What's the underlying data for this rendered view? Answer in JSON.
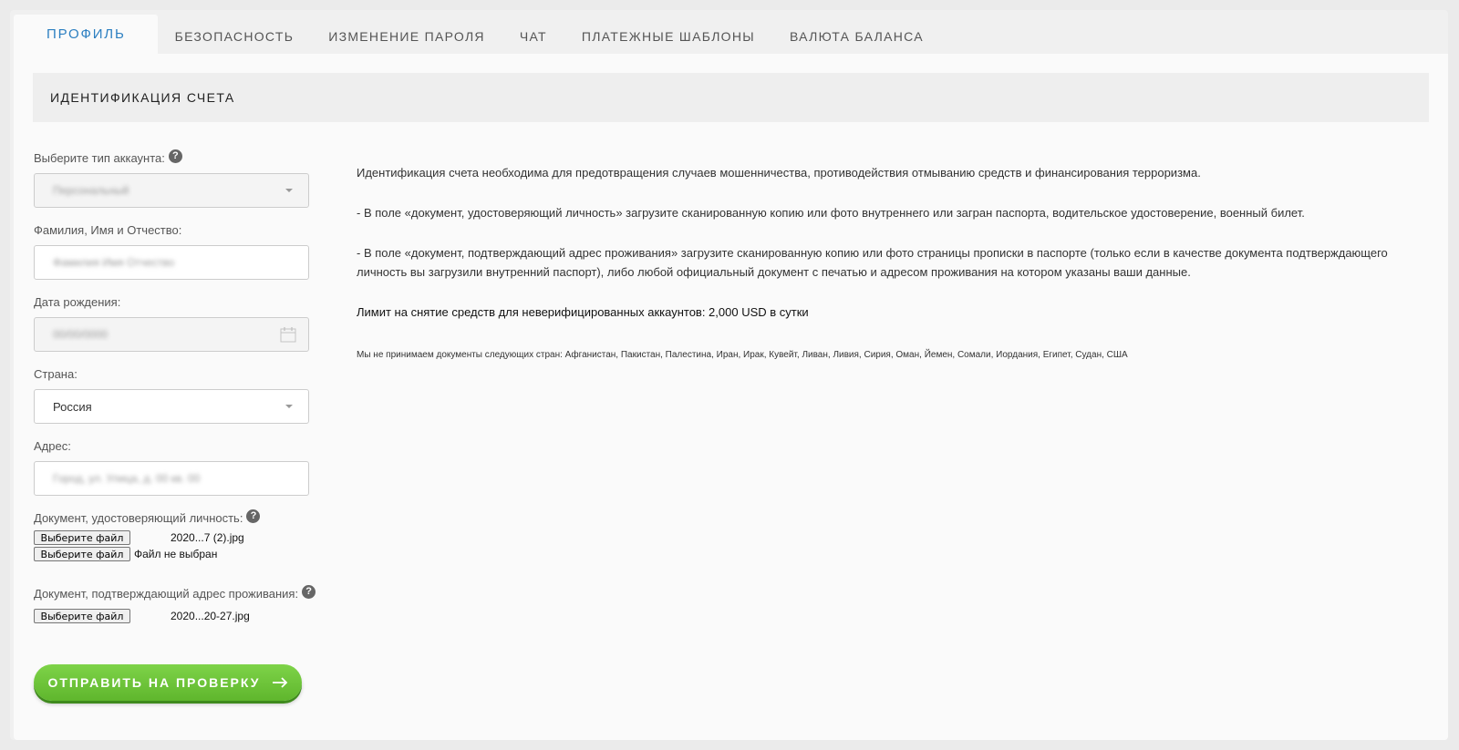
{
  "tabs": [
    {
      "label": "ПРОФИЛЬ",
      "active": true
    },
    {
      "label": "БЕЗОПАСНОСТЬ"
    },
    {
      "label": "ИЗМЕНЕНИЕ ПАРОЛЯ"
    },
    {
      "label": "ЧАТ"
    },
    {
      "label": "ПЛАТЕЖНЫЕ ШАБЛОНЫ"
    },
    {
      "label": "ВАЛЮТА БАЛАНСА"
    }
  ],
  "section": {
    "title": "ИДЕНТИФИКАЦИЯ СЧЕТА"
  },
  "form": {
    "account_type": {
      "label": "Выберите тип аккаунта:",
      "value": "Персональный"
    },
    "full_name": {
      "label": "Фамилия, Имя и Отчество:",
      "value": "Фамилия Имя Отчество"
    },
    "birth_date": {
      "label": "Дата рождения:",
      "value": "00/00/0000"
    },
    "country": {
      "label": "Страна:",
      "value": "Россия"
    },
    "address": {
      "label": "Адрес:",
      "value": "Город, ул. Улица, д. 00 кв. 00"
    },
    "id_document": {
      "label": "Документ, удостоверяющий личность:",
      "button_label": "Выберите файл",
      "file_name": "2020...7 (2).jpg",
      "button2_label": "Выберите файл",
      "no_file_text": "Файл не выбран"
    },
    "address_document": {
      "label": "Документ, подтверждающий адрес проживания:",
      "button_label": "Выберите файл",
      "file_name": "2020...20-27.jpg"
    },
    "submit_label": "ОТПРАВИТЬ НА ПРОВЕРКУ"
  },
  "info": {
    "intro": "Идентификация счета необходима для предотвращения случаев мошенничества, противодействия отмыванию средств и финансирования терроризма.",
    "id_instructions": "- В поле «документ, удостоверяющий личность» загрузите сканированную копию или фото внутреннего или загран паспорта, водительское удостоверение, военный билет.",
    "address_instructions": "- В поле «документ, подтверждающий адрес проживания» загрузите сканированную копию или фото страницы прописки в паспорте (только если в качестве документа подтверждающего личность вы загрузили внутренний паспорт), либо любой официальный документ с печатью и адресом проживания на котором указаны ваши данные.",
    "limit": "Лимит на снятие средств для неверифицированных аккаунтов: 2,000 USD в сутки",
    "countries": "Мы не принимаем документы следующих стран: Афганистан, Пакистан, Палестина, Иран, Ирак, Кувейт, Ливан, Ливия, Сирия, Оман, Йемен, Сомали, Иордания, Египет, Судан, США"
  },
  "colors": {
    "accent": "#2c7fc1",
    "submit_green": "#6cc33a"
  }
}
